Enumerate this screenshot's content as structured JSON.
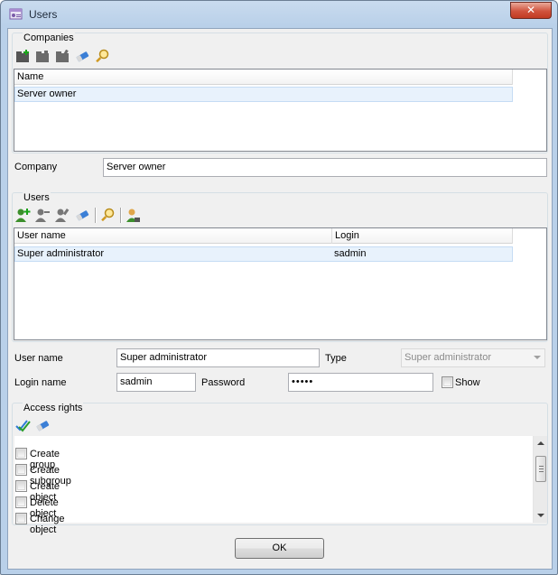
{
  "window": {
    "title": "Users",
    "close_label": "✕"
  },
  "companies": {
    "title": "Companies",
    "toolbar": [
      "add-folder-icon",
      "folder-icon",
      "edit-folder-icon",
      "eraser-icon",
      "search-icon"
    ],
    "columns": [
      "Name"
    ],
    "rows": [
      [
        "Server owner"
      ]
    ]
  },
  "company_field": {
    "label": "Company",
    "value": "Server owner"
  },
  "users": {
    "title": "Users",
    "toolbar": [
      "add-user-icon",
      "remove-user-icon",
      "edit-user-icon",
      "eraser-icon",
      "search-icon",
      "user-group-icon"
    ],
    "columns": [
      "User name",
      "Login"
    ],
    "rows": [
      [
        "Super administrator",
        "sadmin"
      ]
    ]
  },
  "user_form": {
    "user_name_label": "User name",
    "user_name_value": "Super administrator",
    "type_label": "Type",
    "type_value": "Super administrator",
    "login_label": "Login name",
    "login_value": "sadmin",
    "password_label": "Password",
    "password_value": "•••••",
    "show_label": "Show"
  },
  "access_rights": {
    "title": "Access rights",
    "toolbar": [
      "check-all-icon",
      "eraser-icon"
    ],
    "items": [
      "Create group",
      "Create subgroup",
      "Create object",
      "Delete object",
      "Change object"
    ]
  },
  "ok_label": "OK"
}
